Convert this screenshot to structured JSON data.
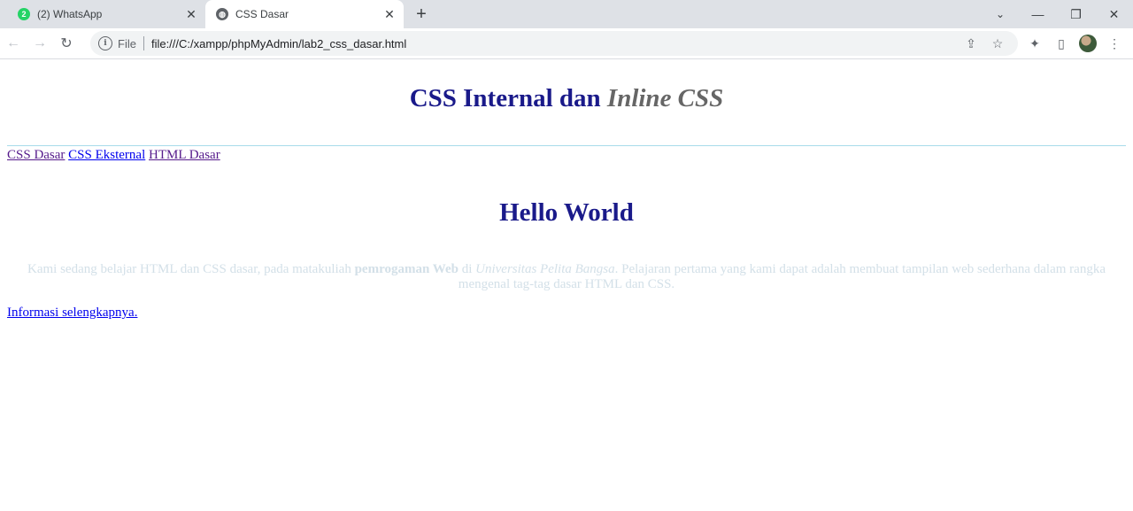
{
  "tabs": [
    {
      "title": "(2) WhatsApp",
      "badge": "2",
      "active": false
    },
    {
      "title": "CSS Dasar",
      "active": true
    }
  ],
  "omnibox": {
    "scheme": "File",
    "url": "file:///C:/xampp/phpMyAdmin/lab2_css_dasar.html"
  },
  "page": {
    "heading_part1": "CSS Internal dan ",
    "heading_part2": "Inline CSS",
    "nav": [
      "CSS Dasar",
      "CSS Eksternal",
      "HTML Dasar"
    ],
    "subheading": "Hello World",
    "intro": {
      "text1": "Kami sedang belajar HTML dan CSS dasar, pada matakuliah ",
      "bold": "pemrogaman Web",
      "text2": " di ",
      "italic": "Universitas Pelita Bangsa",
      "text3": ". Pelajaran pertama yang kami dapat adalah membuat tampilan web sederhana dalam rangka mengenal tag-tag dasar HTML dan CSS."
    },
    "more_link": "Informasi selengkapnya."
  },
  "colors": {
    "heading": "#1a1a8a",
    "italic_heading": "#666666",
    "intro_text": "#d3e0e8",
    "hr": "#a8dcea"
  }
}
